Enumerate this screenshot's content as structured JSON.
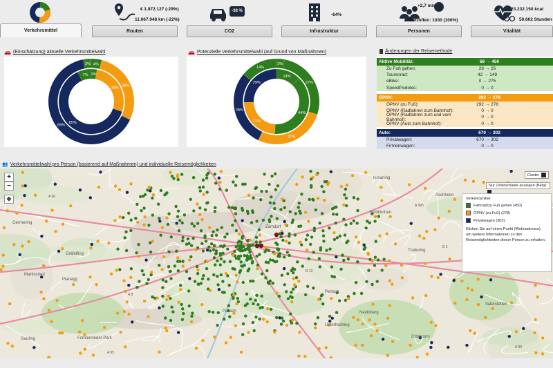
{
  "nav": {
    "tabs": [
      {
        "label": "Verkehrsmittel",
        "active": true
      },
      {
        "label": "Routen",
        "stats": [
          "€ 1.872.127 (-29%)",
          "11.067.048 km (-22%)"
        ]
      },
      {
        "label": "CO2",
        "stats": [
          "-38 %"
        ]
      },
      {
        "label": "Infrastruktur",
        "stats": [
          "-64%"
        ]
      },
      {
        "label": "Personen",
        "stats": [
          "+2,7 min",
          "Getroffen: 1030 (100%)"
        ]
      },
      {
        "label": "Vitalität",
        "stats": [
          "23.232.150 kcal",
          "50.602 Stunden"
        ]
      }
    ]
  },
  "current": {
    "title": "(Einschätzung) aktuelle Verkehrsmittelwahl",
    "outer": [
      {
        "pct": "4%",
        "v": 4,
        "c": "#2e7d1e"
      },
      {
        "pct": "28%",
        "v": 28,
        "c": "#f39c12"
      },
      {
        "pct": "65%",
        "v": 65,
        "c": "#15295e"
      },
      {
        "pct": "3%",
        "v": 3,
        "c": "#2e7d1e"
      }
    ],
    "inner": [
      {
        "pct": "3%",
        "v": 3,
        "c": "#2e7d1e"
      },
      {
        "pct": "28%",
        "v": 28,
        "c": "#f39c12"
      },
      {
        "pct": "65%",
        "v": 65,
        "c": "#15295e"
      },
      {
        "pct": "7%",
        "v": 7,
        "c": "#2e7d1e"
      }
    ]
  },
  "potential": {
    "title": "Potenzielle Verkehrsmittelwahl (auf Grund von Maßnahmen)",
    "outer": [
      {
        "pct": "3%",
        "v": 3,
        "c": "#2e7d1e"
      },
      {
        "pct": "27%",
        "v": 27,
        "c": "#2e7d1e"
      },
      {
        "pct": "27%",
        "v": 27,
        "c": "#f39c12"
      },
      {
        "pct": "29%",
        "v": 29,
        "c": "#15295e"
      },
      {
        "pct": "14%",
        "v": 14,
        "c": "#2e7d1e"
      }
    ],
    "inner": [
      {
        "pct": "14%",
        "v": 14,
        "c": "#2e7d1e"
      },
      {
        "pct": "44%",
        "v": 44,
        "c": "#2e7d1e"
      },
      {
        "pct": "27%",
        "v": 27,
        "c": "#f39c12"
      },
      {
        "pct": "29%",
        "v": 29,
        "c": "#15295e"
      }
    ]
  },
  "changes": {
    "title": "Änderungen der Reisemethode",
    "groups": [
      {
        "name": "Aktive Mobilität:",
        "value": "68 → 450",
        "head": "#2e7d1e",
        "body": "#cde8c2",
        "rows": [
          {
            "name": "Zu Fuß gehen:",
            "value": "26 → 26"
          },
          {
            "name": "Tourenrad:",
            "value": "42 → 149"
          },
          {
            "name": "eBike:",
            "value": "0 → 275"
          },
          {
            "name": "SpeedPedelec:",
            "value": "0 → 0"
          }
        ]
      },
      {
        "name": "ÖPNV:",
        "value": "292 → 278",
        "head": "#f39c12",
        "body": "#fce7c4",
        "rows": [
          {
            "name": "ÖPNV (zu Fuß):",
            "value": "292 → 278"
          },
          {
            "name": "ÖPNV (Radfahren zum Bahnhof):",
            "value": "0 → 0"
          },
          {
            "name": "ÖPNV (Radfahren zum und vom Bahnhof):",
            "value": "0 → 0"
          },
          {
            "name": "ÖPNV (Auto zum Bahnhof):",
            "value": "0 → 0"
          }
        ]
      },
      {
        "name": "Auto:",
        "value": "670 → 302",
        "head": "#15295e",
        "body": "#d4dbec",
        "rows": [
          {
            "name": "Privatwagen:",
            "value": "670 → 302"
          },
          {
            "name": "Firmenwagen:",
            "value": "0 → 0"
          }
        ]
      }
    ]
  },
  "map": {
    "title": "Verkehrsmittelwahl pro Person (basierend auf Maßnahmen) und individuelle Reisemöglichkeiten",
    "zoom_in": "+",
    "zoom_out": "−",
    "pan": "✥",
    "cluster_label": "Cluster",
    "diff_label": "Nur Unterschiede anzeigen (Beta):",
    "legend": {
      "title": "Verkehrsmittel",
      "items": [
        {
          "label": "Fahrrad/zu Fuß gehen (450)",
          "color": "#2e7d1e"
        },
        {
          "label": "ÖPNV (zu Fuß) (278)",
          "color": "#f39c12"
        },
        {
          "label": "Privatwagen (302)",
          "color": "#15295e"
        }
      ],
      "note": "Klicken Sie auf einen Punkt (Wohnadresse), um weitere Informationen zu den Reisemöglichkeiten dieser Person zu erhalten."
    },
    "places": [
      "Germering",
      "Gräfelfing",
      "Planegg",
      "Gauting",
      "Pullach",
      "Unterhaching",
      "Ottobrunn",
      "Haar",
      "Vaterstetten",
      "Feldkirchen",
      "Zamdorf",
      "Neubiberg",
      "Trudering",
      "Aschheim",
      "Ismaning",
      "Perlach",
      "Forstenrieder Park",
      "Martinsried"
    ],
    "road_labels": [
      "A 95",
      "A 99",
      "B 2",
      "A 8",
      "B 13",
      "B 471",
      "A 96",
      "A 995"
    ]
  }
}
